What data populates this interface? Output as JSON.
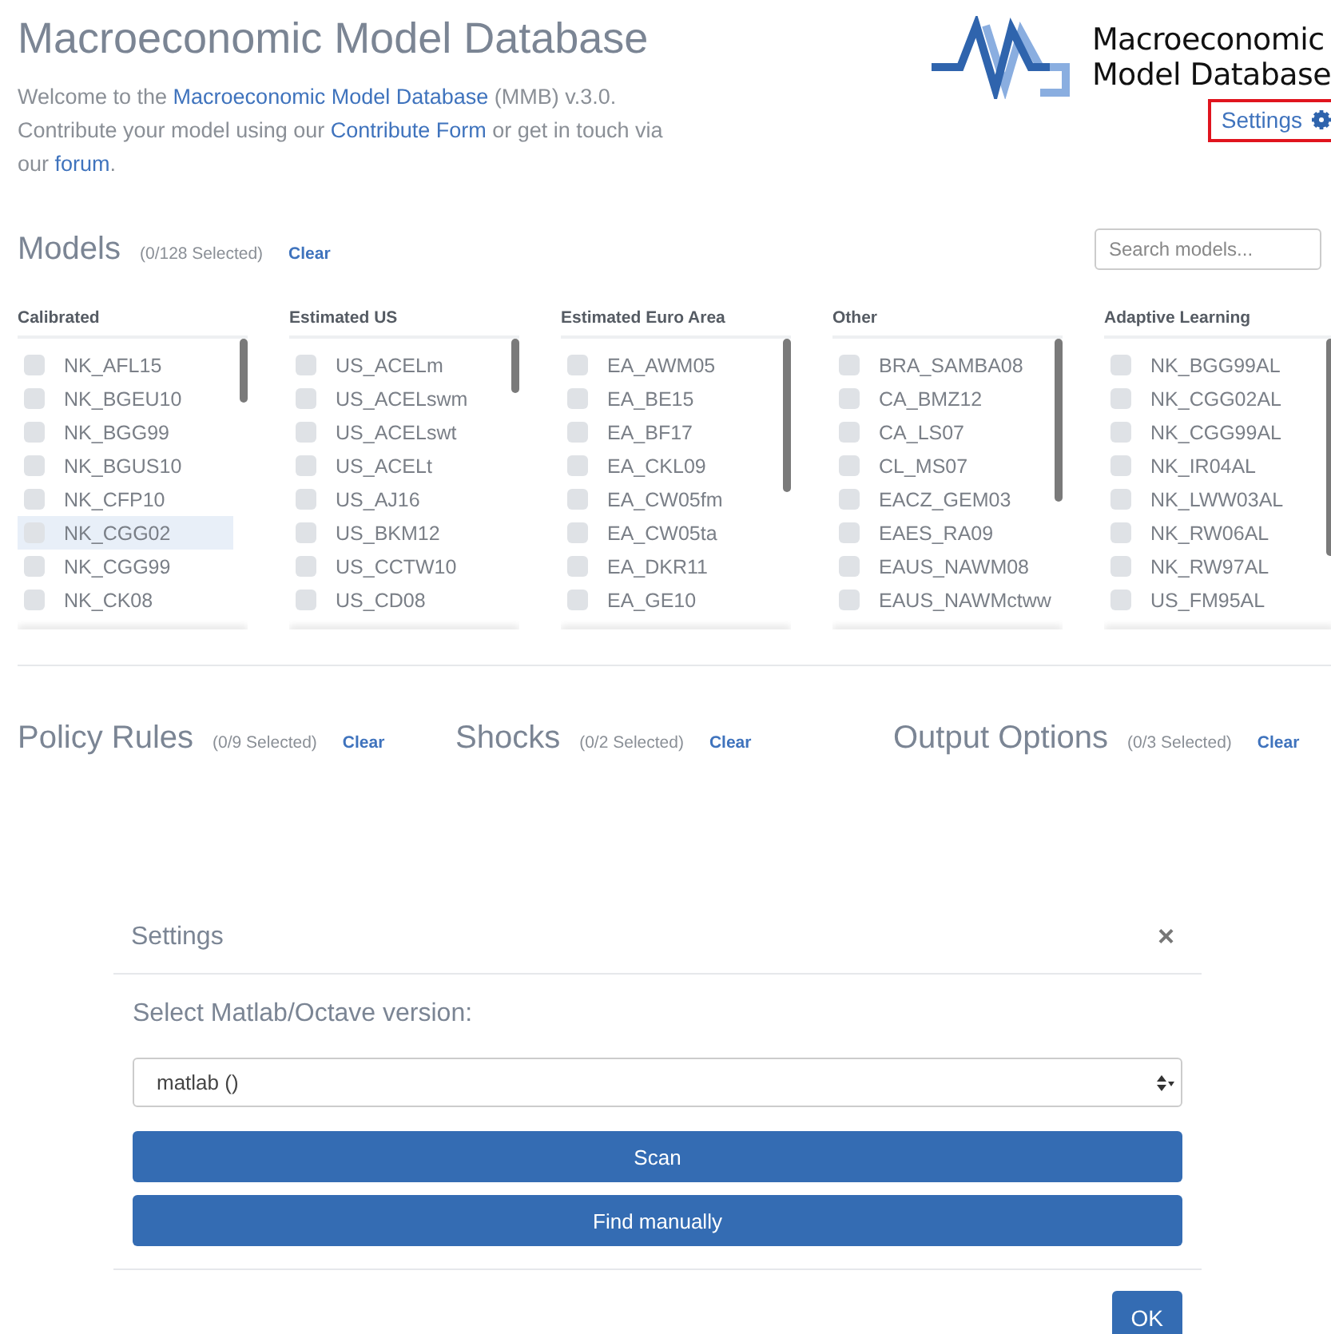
{
  "header": {
    "title": "Macroeconomic Model Database",
    "intro": [
      {
        "kind": "text",
        "text": "Welcome to the "
      },
      {
        "kind": "link",
        "text": "Macroeconomic Model Database"
      },
      {
        "kind": "text",
        "text": " (MMB) v.3.0. Contribute your model using our "
      },
      {
        "kind": "link",
        "text": "Contribute Form"
      },
      {
        "kind": "text",
        "text": " or get in touch via our "
      },
      {
        "kind": "link",
        "text": "forum"
      },
      {
        "kind": "text",
        "text": "."
      }
    ],
    "logo_lines": [
      "Macroeconomic",
      "Model Database"
    ],
    "settings_link": {
      "label": "Settings",
      "outlined": true
    }
  },
  "models": {
    "title": "Models",
    "count": "(0/128 Selected)",
    "clear": "Clear",
    "search": {
      "placeholder": "Search models..."
    },
    "groups": [
      {
        "title": "Calibrated",
        "items": [
          {
            "label": "NK_AFL15",
            "checked": false,
            "highlighted": false
          },
          {
            "label": "NK_BGEU10",
            "checked": false,
            "highlighted": false
          },
          {
            "label": "NK_BGG99",
            "checked": false,
            "highlighted": false
          },
          {
            "label": "NK_BGUS10",
            "checked": false,
            "highlighted": false
          },
          {
            "label": "NK_CFP10",
            "checked": false,
            "highlighted": false
          },
          {
            "label": "NK_CGG02",
            "checked": false,
            "highlighted": true
          },
          {
            "label": "NK_CGG99",
            "checked": false,
            "highlighted": false
          },
          {
            "label": "NK_CK08",
            "checked": false,
            "highlighted": false
          }
        ]
      },
      {
        "title": "Estimated US",
        "items": [
          {
            "label": "US_ACELm",
            "checked": false,
            "highlighted": false
          },
          {
            "label": "US_ACELswm",
            "checked": false,
            "highlighted": false
          },
          {
            "label": "US_ACELswt",
            "checked": false,
            "highlighted": false
          },
          {
            "label": "US_ACELt",
            "checked": false,
            "highlighted": false
          },
          {
            "label": "US_AJ16",
            "checked": false,
            "highlighted": false
          },
          {
            "label": "US_BKM12",
            "checked": false,
            "highlighted": false
          },
          {
            "label": "US_CCTW10",
            "checked": false,
            "highlighted": false
          },
          {
            "label": "US_CD08",
            "checked": false,
            "highlighted": false
          }
        ]
      },
      {
        "title": "Estimated Euro Area",
        "items": [
          {
            "label": "EA_AWM05",
            "checked": false,
            "highlighted": false
          },
          {
            "label": "EA_BE15",
            "checked": false,
            "highlighted": false
          },
          {
            "label": "EA_BF17",
            "checked": false,
            "highlighted": false
          },
          {
            "label": "EA_CKL09",
            "checked": false,
            "highlighted": false
          },
          {
            "label": "EA_CW05fm",
            "checked": false,
            "highlighted": false
          },
          {
            "label": "EA_CW05ta",
            "checked": false,
            "highlighted": false
          },
          {
            "label": "EA_DKR11",
            "checked": false,
            "highlighted": false
          },
          {
            "label": "EA_GE10",
            "checked": false,
            "highlighted": false
          }
        ]
      },
      {
        "title": "Other",
        "items": [
          {
            "label": "BRA_SAMBA08",
            "checked": false,
            "highlighted": false
          },
          {
            "label": "CA_BMZ12",
            "checked": false,
            "highlighted": false
          },
          {
            "label": "CA_LS07",
            "checked": false,
            "highlighted": false
          },
          {
            "label": "CL_MS07",
            "checked": false,
            "highlighted": false
          },
          {
            "label": "EACZ_GEM03",
            "checked": false,
            "highlighted": false
          },
          {
            "label": "EAES_RA09",
            "checked": false,
            "highlighted": false
          },
          {
            "label": "EAUS_NAWM08",
            "checked": false,
            "highlighted": false
          },
          {
            "label": "EAUS_NAWMctww",
            "checked": false,
            "highlighted": false
          }
        ]
      },
      {
        "title": "Adaptive Learning",
        "items": [
          {
            "label": "NK_BGG99AL",
            "checked": false,
            "highlighted": false
          },
          {
            "label": "NK_CGG02AL",
            "checked": false,
            "highlighted": false
          },
          {
            "label": "NK_CGG99AL",
            "checked": false,
            "highlighted": false
          },
          {
            "label": "NK_IR04AL",
            "checked": false,
            "highlighted": false
          },
          {
            "label": "NK_LWW03AL",
            "checked": false,
            "highlighted": false
          },
          {
            "label": "NK_RW06AL",
            "checked": false,
            "highlighted": false
          },
          {
            "label": "NK_RW97AL",
            "checked": false,
            "highlighted": false
          },
          {
            "label": "US_FM95AL",
            "checked": false,
            "highlighted": false
          }
        ]
      }
    ]
  },
  "sections": [
    {
      "title": "Policy Rules",
      "count": "(0/9 Selected)",
      "clear": "Clear"
    },
    {
      "title": "Shocks",
      "count": "(0/2 Selected)",
      "clear": "Clear"
    },
    {
      "title": "Output Options",
      "count": "(0/3 Selected)",
      "clear": "Clear"
    }
  ],
  "dialog": {
    "title": "Settings",
    "close": "×",
    "prompt": "Select Matlab/Octave version:",
    "select": {
      "value": "matlab ()"
    },
    "buttons": [
      {
        "label": "Scan",
        "kind": "wide"
      },
      {
        "label": "Find manually",
        "kind": "wide"
      }
    ],
    "footer_button": {
      "label": "OK"
    }
  }
}
